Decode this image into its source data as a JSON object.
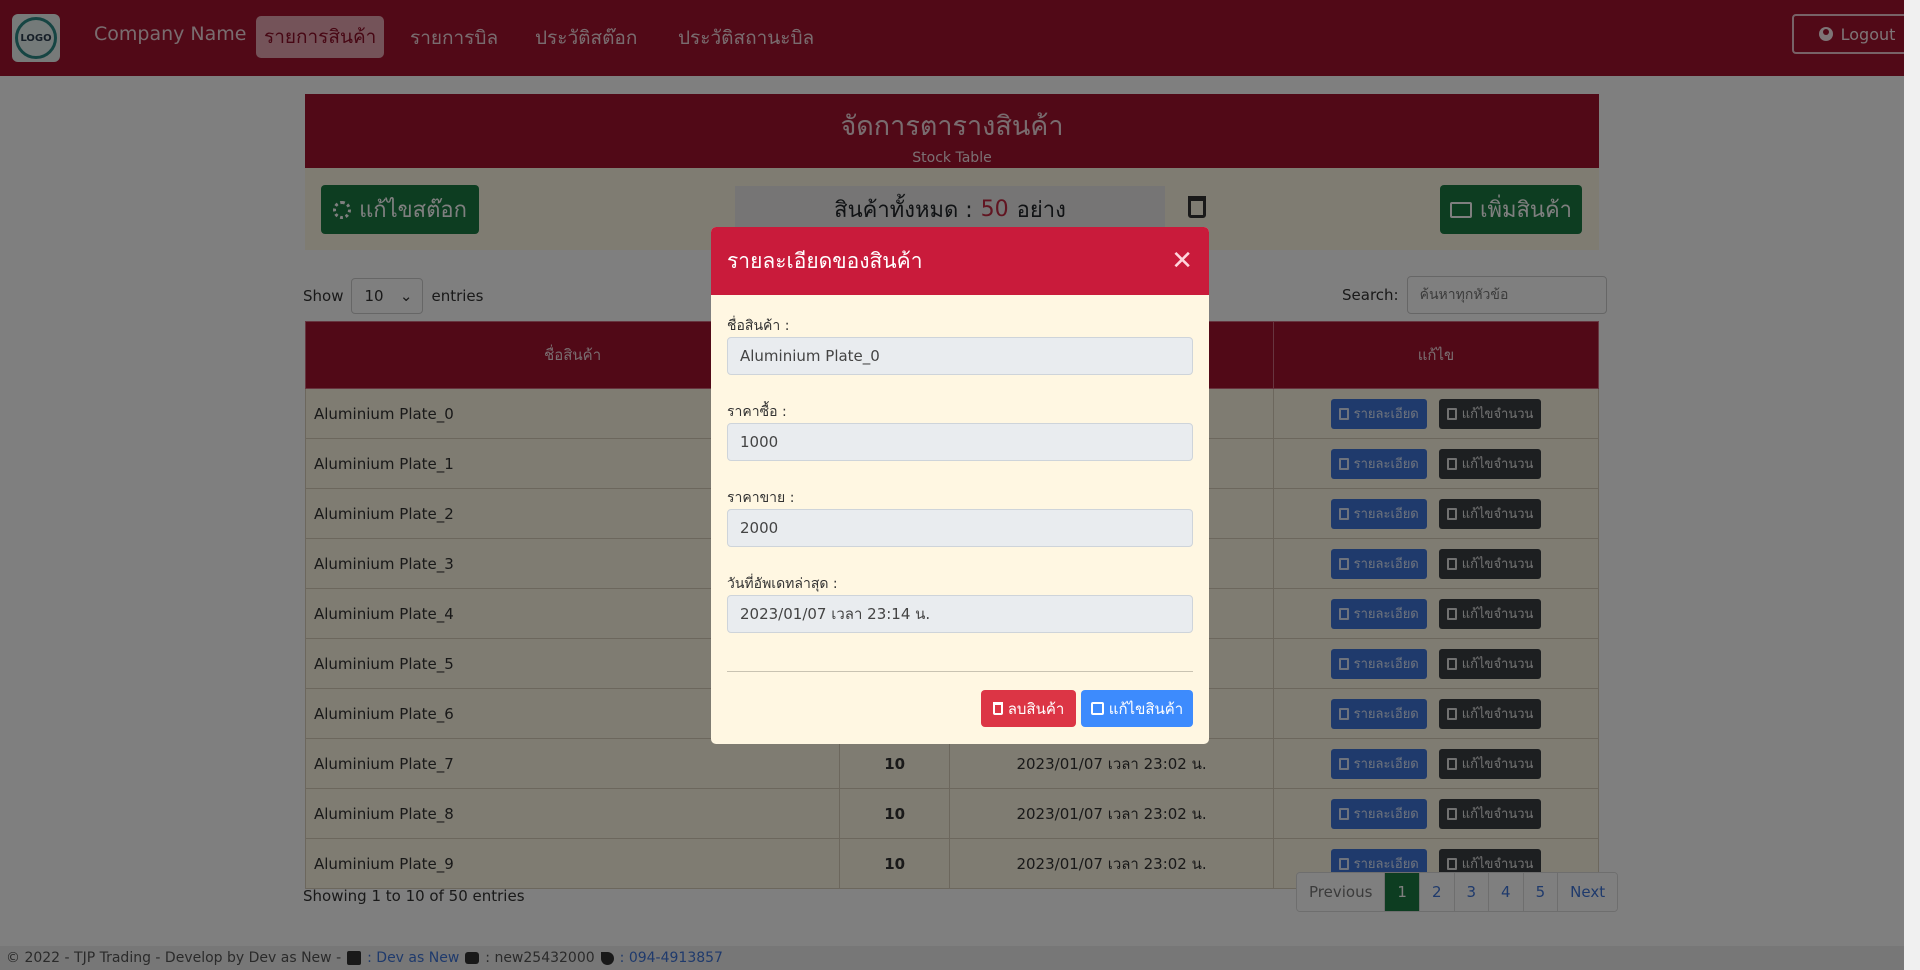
{
  "nav": {
    "logo_text": "LOGO",
    "brand": "Company Name",
    "items": [
      {
        "label": "รายการสินค้า",
        "active": true
      },
      {
        "label": "รายการบิล",
        "active": false
      },
      {
        "label": "ประวัติสต๊อก",
        "active": false
      },
      {
        "label": "ประวัติสถานะบิล",
        "active": false
      }
    ],
    "logout_label": "Logout"
  },
  "panel": {
    "title": "จัดการตารางสินค้า",
    "subtitle": "Stock Table",
    "edit_stock_label": "แก้ไขสต๊อก",
    "total_prefix": "สินค้าทั้งหมด :",
    "total_count": "50",
    "total_suffix": "อย่าง",
    "add_product_label": "เพิ่มสินค้า"
  },
  "table_controls": {
    "show_label": "Show",
    "entries_value": "10",
    "entries_label": "entries",
    "search_label": "Search:",
    "search_placeholder": "ค้นหาทุกหัวข้อ"
  },
  "table": {
    "headers": [
      "ชื่อสินค้า",
      "",
      "",
      "แก้ไข"
    ],
    "detail_button": "รายละเอียด",
    "edit_qty_button": "แก้ไขจำนวน",
    "rows": [
      {
        "name": "Aluminium Plate_0",
        "qty": "",
        "date": ""
      },
      {
        "name": "Aluminium Plate_1",
        "qty": "",
        "date": ""
      },
      {
        "name": "Aluminium Plate_2",
        "qty": "",
        "date": ""
      },
      {
        "name": "Aluminium Plate_3",
        "qty": "",
        "date": ""
      },
      {
        "name": "Aluminium Plate_4",
        "qty": "",
        "date": ""
      },
      {
        "name": "Aluminium Plate_5",
        "qty": "",
        "date": ""
      },
      {
        "name": "Aluminium Plate_6",
        "qty": "",
        "date": ""
      },
      {
        "name": "Aluminium Plate_7",
        "qty": "10",
        "date": "2023/01/07 เวลา 23:02 น."
      },
      {
        "name": "Aluminium Plate_8",
        "qty": "10",
        "date": "2023/01/07 เวลา 23:02 น."
      },
      {
        "name": "Aluminium Plate_9",
        "qty": "10",
        "date": "2023/01/07 เวลา 23:02 น."
      }
    ]
  },
  "pagination": {
    "info": "Showing 1 to 10 of 50 entries",
    "previous": "Previous",
    "pages": [
      "1",
      "2",
      "3",
      "4",
      "5"
    ],
    "next": "Next"
  },
  "footer": {
    "copyright": "© 2022 - TJP Trading - Develop by Dev as New -",
    "facebook_label": ": Dev as New",
    "line_label": ": new25432000",
    "phone_label": ": 094-4913857"
  },
  "modal": {
    "title": "รายละเอียดของสินค้า",
    "fields": [
      {
        "label": "ชื่อสินค้า :",
        "value": "Aluminium Plate_0"
      },
      {
        "label": "ราคาซื้อ :",
        "value": "1000"
      },
      {
        "label": "ราคาขาย :",
        "value": "2000"
      },
      {
        "label": "วันที่อัพเดทล่าสุด :",
        "value": "2023/01/07 เวลา 23:14 น."
      }
    ],
    "delete_label": "ลบสินค้า",
    "edit_label": "แก้ไขสินค้า"
  }
}
